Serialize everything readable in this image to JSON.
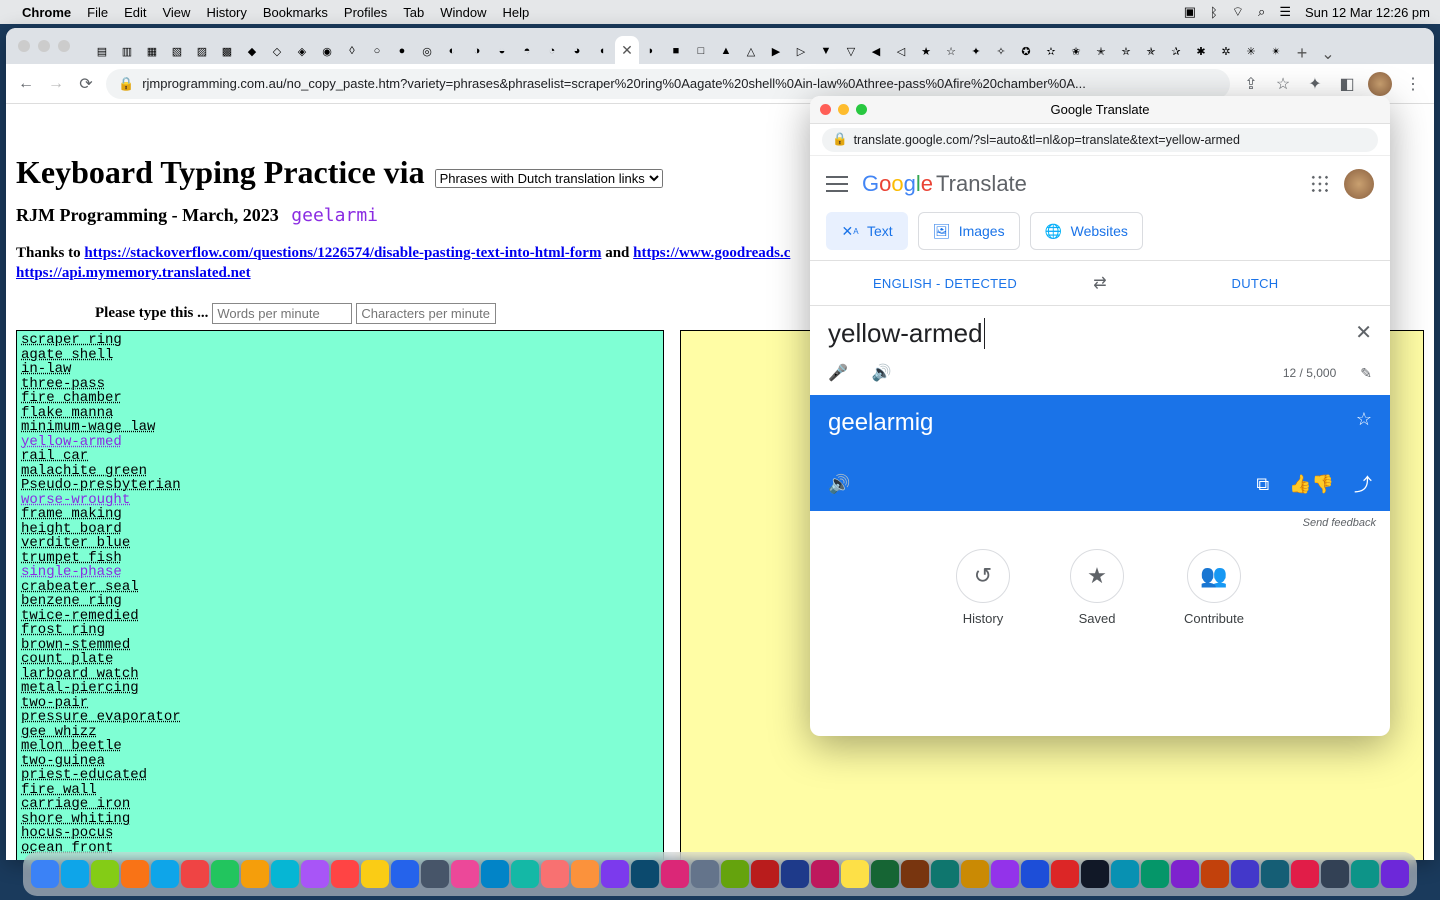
{
  "menubar": {
    "app": "Chrome",
    "items": [
      "File",
      "Edit",
      "View",
      "History",
      "Bookmarks",
      "Profiles",
      "Tab",
      "Window",
      "Help"
    ],
    "battery": "⚡",
    "clock": "Sun 12 Mar  12:26 pm"
  },
  "chrome": {
    "url": "rjmprogramming.com.au/no_copy_paste.htm?variety=phrases&phraselist=scraper%20ring%0Aagate%20shell%0Ain-law%0Athree-pass%0Afire%20chamber%0A..."
  },
  "page": {
    "h1": "Keyboard Typing Practice via",
    "select": "Phrases with Dutch translation links",
    "subtitle_prefix": "RJM Programming - March, 2023",
    "subtitle_purple": "geelarmi",
    "thanks_prefix": "Thanks to ",
    "thanks_link1": "https://stackoverflow.com/questions/1226574/disable-pasting-text-into-html-form",
    "thanks_mid": " and ",
    "thanks_link2": "https://www.goodreads.c",
    "thanks_link3": "https://api.mymemory.translated.net",
    "controls_label": "Please type this ...",
    "wpm_placeholder": "Words per minute",
    "cpm_placeholder": "Characters per minute",
    "phrases": [
      {
        "t": "scraper ring",
        "v": false
      },
      {
        "t": "agate shell",
        "v": false
      },
      {
        "t": "in-law",
        "v": false
      },
      {
        "t": "three-pass",
        "v": false
      },
      {
        "t": "fire chamber",
        "v": false
      },
      {
        "t": "flake manna",
        "v": false
      },
      {
        "t": "minimum-wage law",
        "v": false
      },
      {
        "t": "yellow-armed",
        "v": true
      },
      {
        "t": "rail car",
        "v": false
      },
      {
        "t": "malachite green",
        "v": false
      },
      {
        "t": "Pseudo-presbyterian",
        "v": false
      },
      {
        "t": "worse-wrought",
        "v": true
      },
      {
        "t": "frame making",
        "v": false
      },
      {
        "t": "height board",
        "v": false
      },
      {
        "t": "verditer blue",
        "v": false
      },
      {
        "t": "trumpet fish",
        "v": false
      },
      {
        "t": "single-phase",
        "v": true
      },
      {
        "t": "crabeater seal",
        "v": false
      },
      {
        "t": "benzene ring",
        "v": false
      },
      {
        "t": "twice-remedied",
        "v": false
      },
      {
        "t": "frost ring",
        "v": false
      },
      {
        "t": "brown-stemmed",
        "v": false
      },
      {
        "t": "count plate",
        "v": false
      },
      {
        "t": "larboard watch",
        "v": false
      },
      {
        "t": "metal-piercing",
        "v": false
      },
      {
        "t": "two-pair",
        "v": false
      },
      {
        "t": "pressure evaporator",
        "v": false
      },
      {
        "t": "gee whizz",
        "v": false
      },
      {
        "t": "melon beetle",
        "v": false
      },
      {
        "t": "two-guinea",
        "v": false
      },
      {
        "t": "priest-educated",
        "v": false
      },
      {
        "t": "fire wall",
        "v": false
      },
      {
        "t": "carriage iron",
        "v": false
      },
      {
        "t": "shore whiting",
        "v": false
      },
      {
        "t": "hocus-pocus",
        "v": false
      },
      {
        "t": "ocean front",
        "v": false
      }
    ]
  },
  "gt": {
    "title": "Google Translate",
    "url": "translate.google.com/?sl=auto&tl=nl&op=translate&text=yellow-armed",
    "translate_word": "Translate",
    "modes": {
      "text": "Text",
      "images": "Images",
      "websites": "Websites"
    },
    "src_lang": "ENGLISH - DETECTED",
    "tgt_lang": "DUTCH",
    "src_text": "yellow-armed",
    "char_count": "12 / 5,000",
    "out_text": "geelarmig",
    "feedback": "Send feedback",
    "history": "History",
    "saved": "Saved",
    "contribute": "Contribute"
  },
  "dock_colors": [
    "#3b82f6",
    "#0ea5e9",
    "#84cc16",
    "#f97316",
    "#0ea5e9",
    "#ef4444",
    "#22c55e",
    "#f59e0b",
    "#06b6d4",
    "#a855f7",
    "#f44",
    "#facc15",
    "#2563eb",
    "#475569",
    "#ec4899",
    "#0284c7",
    "#14b8a6",
    "#f87171",
    "#fb923c",
    "#7c3aed",
    "#0c4a6e",
    "#db2777",
    "#64748b",
    "#65a30d",
    "#b91c1c",
    "#1e3a8a",
    "#be185d",
    "#fde047",
    "#166534",
    "#78350f",
    "#0f766e",
    "#ca8a04",
    "#9333ea",
    "#1d4ed8",
    "#dc2626",
    "#111827",
    "#0891b2",
    "#059669",
    "#7e22ce",
    "#c2410c",
    "#4338ca",
    "#155e75",
    "#e11d48",
    "#334155",
    "#0d9488",
    "#6d28d9"
  ]
}
